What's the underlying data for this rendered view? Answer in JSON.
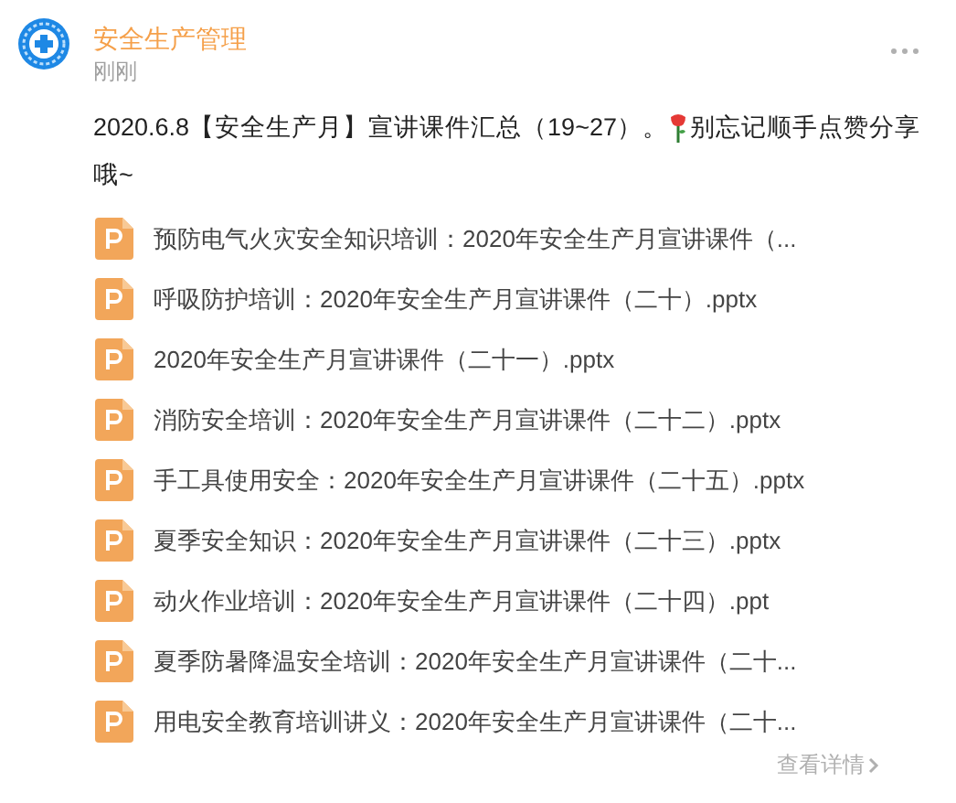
{
  "account": {
    "name": "安全生产管理",
    "time": "刚刚"
  },
  "post": {
    "text_before": "2020.6.8【安全生产月】宣讲课件汇总（19~27）。",
    "text_after": "别忘记顺手点赞分享",
    "text_wrapped": "哦~"
  },
  "files": [
    {
      "kind": "ppt",
      "name": "预防电气火灾安全知识培训：2020年安全生产月宣讲课件（..."
    },
    {
      "kind": "ppt",
      "name": "呼吸防护培训：2020年安全生产月宣讲课件（二十）.pptx"
    },
    {
      "kind": "ppt",
      "name": "2020年安全生产月宣讲课件（二十一）.pptx"
    },
    {
      "kind": "ppt",
      "name": "消防安全培训：2020年安全生产月宣讲课件（二十二）.pptx"
    },
    {
      "kind": "ppt",
      "name": "手工具使用安全：2020年安全生产月宣讲课件（二十五）.pptx"
    },
    {
      "kind": "ppt",
      "name": "夏季安全知识：2020年安全生产月宣讲课件（二十三）.pptx"
    },
    {
      "kind": "ppt",
      "name": "动火作业培训：2020年安全生产月宣讲课件（二十四）.ppt"
    },
    {
      "kind": "ppt",
      "name": "夏季防暑降温安全培训：2020年安全生产月宣讲课件（二十..."
    },
    {
      "kind": "ppt",
      "name": "用电安全教育培训讲义：2020年安全生产月宣讲课件（二十..."
    }
  ],
  "details_link": "查看详情"
}
